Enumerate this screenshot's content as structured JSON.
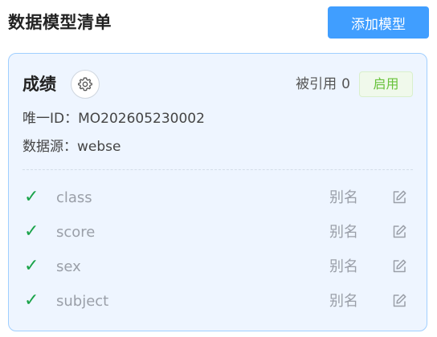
{
  "header": {
    "title": "数据模型清单",
    "add_button_label": "添加模型"
  },
  "card": {
    "model_name": "成绩",
    "settings_icon": "gear-icon",
    "ref_label": "被引用",
    "ref_count": "0",
    "status_label": "启用",
    "unique_id_text": "唯一ID：MO202605230002",
    "data_source_text": "数据源：webse",
    "fields": [
      {
        "name": "class",
        "alias_label": "别名",
        "checked": true
      },
      {
        "name": "score",
        "alias_label": "别名",
        "checked": true
      },
      {
        "name": "sex",
        "alias_label": "别名",
        "checked": true
      },
      {
        "name": "subject",
        "alias_label": "别名",
        "checked": true
      }
    ],
    "field_icons": {
      "check": "check-icon",
      "edit": "edit-icon"
    }
  },
  "colors": {
    "primary": "#409eff",
    "card_background": "#eef5ff",
    "card_border": "#a0cfff",
    "status_green": "#67c23a",
    "check_green": "#1aa34a",
    "muted_text": "#9a9fa8"
  }
}
